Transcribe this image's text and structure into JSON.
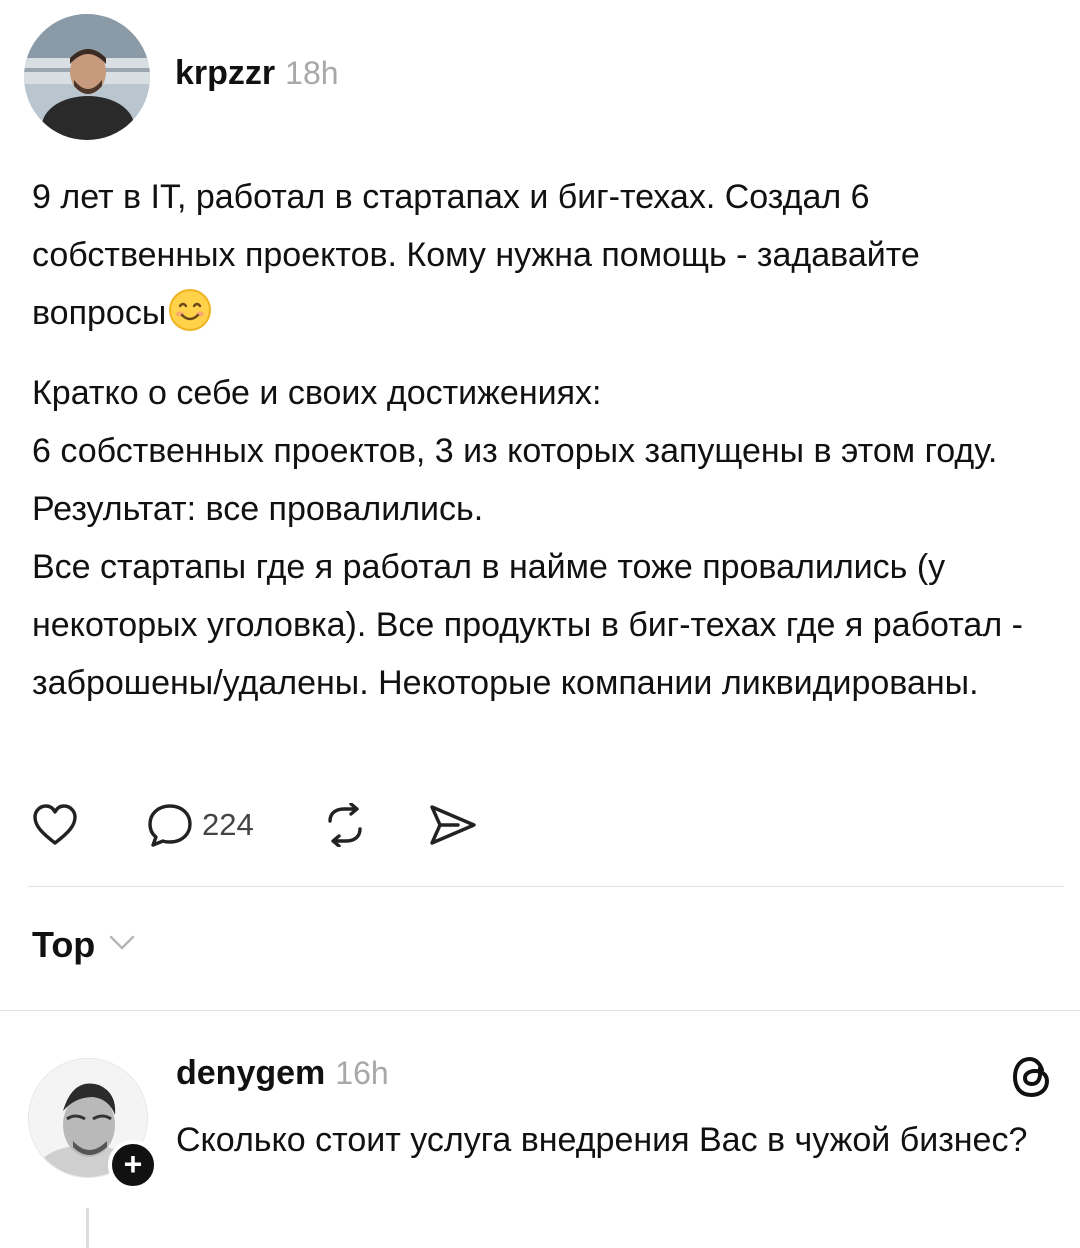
{
  "post": {
    "author": "krpzzr",
    "time": "18h",
    "paragraph1_text": "9 лет в IT, работал в стартапах и биг-техах. Создал 6 собственных проектов. Кому нужна помощь - задавайте вопросы",
    "emoji": "smiling-face-emoji",
    "lines": [
      "Кратко о себе и своих достижениях:",
      "6 собственных проектов, 3 из которых запущены в этом году. Результат: все провалились.",
      "Все стартапы где я работал в найме тоже провалились (у некоторых уголовка). Все продукты в биг-техах где я работал - заброшены/удалены. Некоторые компании ликвидированы."
    ],
    "actions": {
      "like_icon": "heart-icon",
      "reply_icon": "comment-icon",
      "reply_count": "224",
      "repost_icon": "repost-icon",
      "share_icon": "send-icon"
    }
  },
  "sort": {
    "label": "Top",
    "icon": "chevron-down-icon"
  },
  "reply": {
    "author": "denygem",
    "time": "16h",
    "text": "Сколько стоит услуга внедрения Вас в чужой бизнес?",
    "badge": "+",
    "app_icon": "threads-logo-icon"
  },
  "colors": {
    "text": "#111111",
    "muted": "#a8a8a8",
    "divider": "#e3e3e3"
  }
}
